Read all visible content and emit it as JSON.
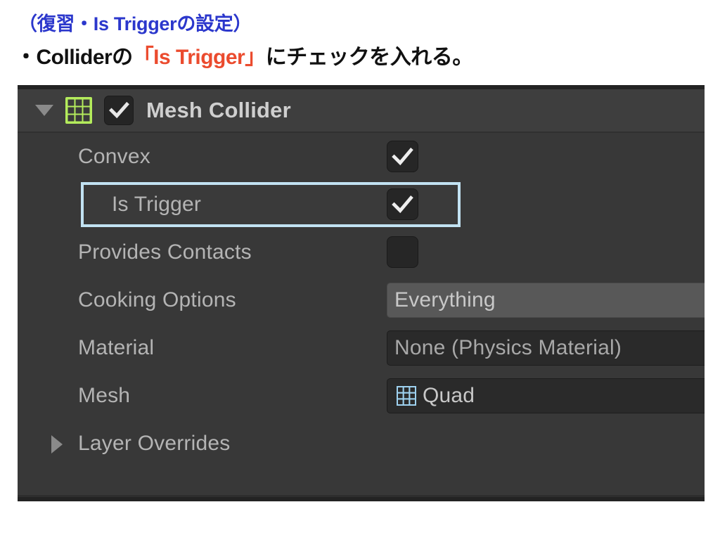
{
  "slide": {
    "title": "（復習・Is Triggerの設定）",
    "bullet_prefix": "・Colliderの",
    "bullet_accent": "「Is Trigger」",
    "bullet_suffix": "にチェックを入れる。",
    "title_color": "#2b37cc",
    "accent_color": "#eb4b2e",
    "body_color": "#111111"
  },
  "inspector": {
    "component": {
      "title": "Mesh Collider",
      "foldout_icon": "triangle-down-icon",
      "type_icon": "mesh-collider-icon",
      "enabled": true,
      "enabled_icon": "check-icon"
    },
    "background_color": "#383838",
    "header_color": "#3e3e3e",
    "highlight_color": "#c2e2f2",
    "rows": [
      {
        "label": "Convex",
        "control": "checkbox",
        "checked": true,
        "highlighted": false
      },
      {
        "label": "Is Trigger",
        "control": "checkbox",
        "checked": true,
        "highlighted": true
      },
      {
        "label": "Provides Contacts",
        "control": "checkbox",
        "checked": false,
        "highlighted": false
      },
      {
        "label": "Cooking Options",
        "control": "popup",
        "value": "Everything",
        "highlighted": false
      },
      {
        "label": "Material",
        "control": "objectfield",
        "value": "None (Physics Material)",
        "highlighted": false
      },
      {
        "label": "Mesh",
        "control": "objectfield-icon",
        "value": "Quad",
        "value_icon": "mesh-asset-icon",
        "highlighted": false
      },
      {
        "label": "Layer Overrides",
        "control": "foldout",
        "foldout_icon": "triangle-right-icon",
        "expanded": false,
        "highlighted": false
      }
    ]
  }
}
